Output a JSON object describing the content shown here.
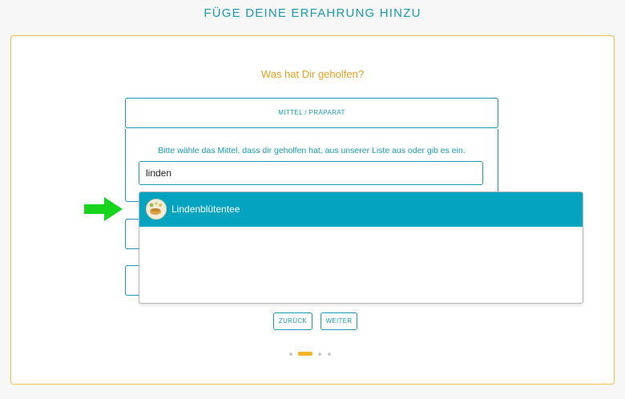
{
  "page": {
    "title": "FÜGE DEINE ERFAHRUNG HINZU"
  },
  "form": {
    "question": "Was hat Dir geholfen?",
    "step_header": "MITTEL / PRÄPARAT",
    "instruction": "Bitte wähle das Mittel, dass dir geholfen hat, aus unserer Liste aus oder gib es ein.",
    "search": {
      "value": "linden"
    },
    "suggestions": [
      {
        "label": "Lindenblütentee",
        "icon": "tea-cup-icon"
      }
    ]
  },
  "buttons": {
    "back": "ZURÜCK",
    "next": "WEITER"
  },
  "pagination": {
    "steps": 4,
    "active": 2
  },
  "colors": {
    "accent": "#1a9ab2",
    "highlight": "#04a3bf",
    "orange": "#e8a020",
    "arrow": "#18d41c"
  }
}
